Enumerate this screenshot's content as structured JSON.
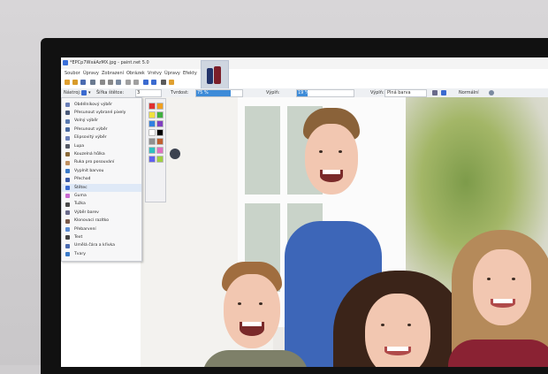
{
  "window": {
    "title": "*EPCp7WxáAzMX.jpg - paint.net 5.0",
    "menu": [
      "Soubor",
      "Úpravy",
      "Zobrazení",
      "Obrázek",
      "Vrstvy",
      "Úpravy",
      "Efekty"
    ]
  },
  "toolbar": {
    "tool_label": "Nástroj:",
    "brush_width_label": "Šířka štětce:",
    "brush_width_value": "3",
    "hardness_label": "Tvrdost:",
    "hardness_value": "75 %",
    "hardness_fraction": 0.75,
    "fill_label": "Výplň:",
    "fill_value": "19 %",
    "fill_fraction": 0.19,
    "fill_mode_label": "Výplň:",
    "fill_mode_value": "Plná barva",
    "blend_value": "Normální"
  },
  "tools": [
    {
      "label": "Obdélníkový výběr",
      "icon": "rect-select-icon",
      "color": "#6a7fb8"
    },
    {
      "label": "Přesunout vybrané pixely",
      "icon": "move-pixels-icon",
      "color": "#4a5a7a"
    },
    {
      "label": "Volný výběr",
      "icon": "lasso-icon",
      "color": "#5a7ab0"
    },
    {
      "label": "Přesunout výběr",
      "icon": "move-selection-icon",
      "color": "#4a6aa0"
    },
    {
      "label": "Elipsovitý výběr",
      "icon": "ellipse-select-icon",
      "color": "#6a7fb8"
    },
    {
      "label": "Lupa",
      "icon": "zoom-icon",
      "color": "#555a66"
    },
    {
      "label": "Kouzelná hůlka",
      "icon": "magic-wand-icon",
      "color": "#8a6a3a"
    },
    {
      "label": "Ruka pro posouvání",
      "icon": "pan-icon",
      "color": "#c09060"
    },
    {
      "label": "Vyplnit barvou",
      "icon": "bucket-icon",
      "color": "#3a7ac8"
    },
    {
      "label": "Přechod",
      "icon": "gradient-icon",
      "color": "#3a5aa8"
    },
    {
      "label": "Štětec",
      "icon": "brush-icon",
      "color": "#3a6ad0"
    },
    {
      "label": "Guma",
      "icon": "eraser-icon",
      "color": "#c86ad0"
    },
    {
      "label": "Tužka",
      "icon": "pencil-icon",
      "color": "#4a4a4a"
    },
    {
      "label": "Výběr barev",
      "icon": "color-picker-icon",
      "color": "#6a6a8a"
    },
    {
      "label": "Klonovací razítko",
      "icon": "clone-stamp-icon",
      "color": "#7a5a4a"
    },
    {
      "label": "Přebarvení",
      "icon": "recolor-icon",
      "color": "#5a8ad0"
    },
    {
      "label": "Text",
      "icon": "text-icon",
      "color": "#444444"
    },
    {
      "label": "Umělá čára a křivka",
      "icon": "line-icon",
      "color": "#4a6ab0"
    },
    {
      "label": "Tvary",
      "icon": "shapes-icon",
      "color": "#3a7ac8"
    }
  ],
  "palette_colors": [
    "#e03030",
    "#f0a020",
    "#f0e040",
    "#40b040",
    "#3080e0",
    "#8040c0",
    "#ffffff",
    "#000000",
    "#909090",
    "#c06030",
    "#30c0c0",
    "#e070c0",
    "#6060f0",
    "#a0d040"
  ],
  "colors": {
    "selection_fill": "#3d8bd8",
    "accent": "#2f6fca"
  }
}
